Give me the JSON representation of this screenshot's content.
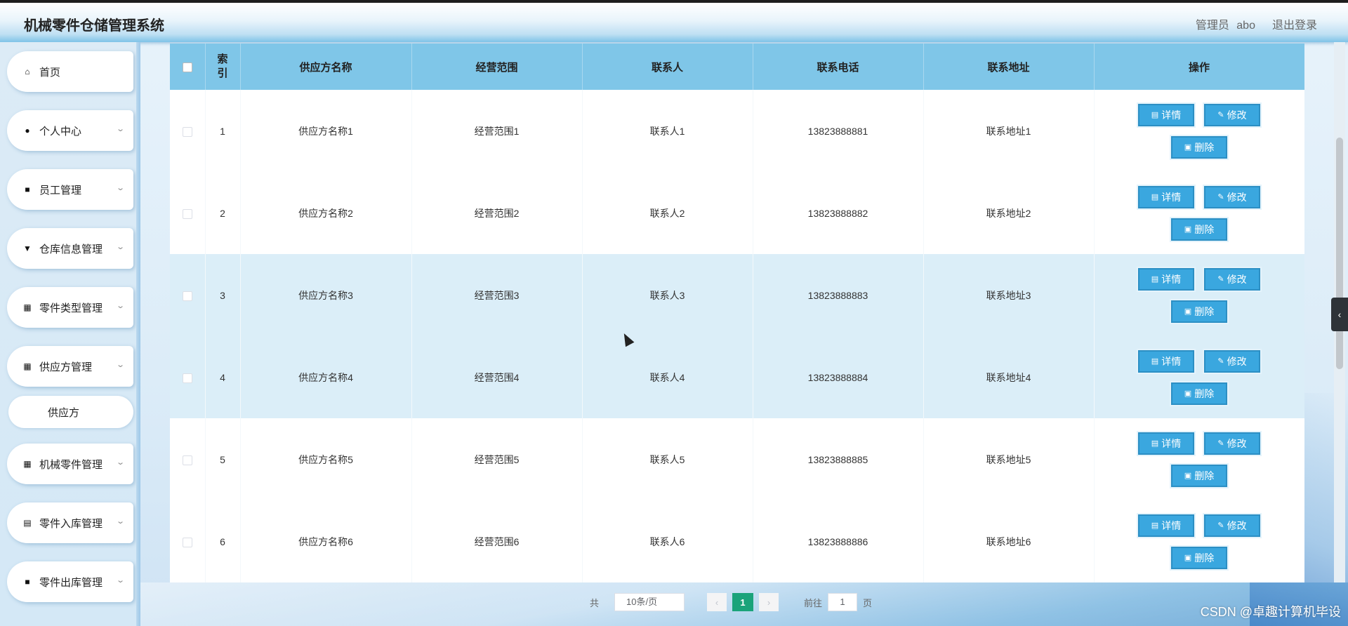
{
  "header": {
    "title": "机械零件仓储管理系统",
    "user_role": "管理员",
    "user_name": "abo",
    "logout": "退出登录"
  },
  "sidebar": {
    "items": [
      {
        "label": "首页",
        "icon": "home-icon",
        "expandable": false
      },
      {
        "label": "个人中心",
        "icon": "user-icon",
        "expandable": true
      },
      {
        "label": "员工管理",
        "icon": "briefcase-icon",
        "expandable": true
      },
      {
        "label": "仓库信息管理",
        "icon": "pin-icon",
        "expandable": true
      },
      {
        "label": "零件类型管理",
        "icon": "grid-icon",
        "expandable": true
      },
      {
        "label": "供应方管理",
        "icon": "grid-icon",
        "expandable": true
      },
      {
        "label": "机械零件管理",
        "icon": "grid-icon",
        "expandable": true
      },
      {
        "label": "零件入库管理",
        "icon": "clipboard-icon",
        "expandable": true
      },
      {
        "label": "零件出库管理",
        "icon": "briefcase-icon",
        "expandable": true
      }
    ],
    "submenu": {
      "label": "供应方"
    }
  },
  "table": {
    "columns": [
      "",
      "索\n引",
      "供应方名称",
      "经营范围",
      "联系人",
      "联系电话",
      "联系地址",
      "操作"
    ],
    "rows": [
      {
        "index": "1",
        "name": "供应方名称1",
        "scope": "经营范围1",
        "contact": "联系人1",
        "phone": "13823888881",
        "address": "联系地址1"
      },
      {
        "index": "2",
        "name": "供应方名称2",
        "scope": "经营范围2",
        "contact": "联系人2",
        "phone": "13823888882",
        "address": "联系地址2"
      },
      {
        "index": "3",
        "name": "供应方名称3",
        "scope": "经营范围3",
        "contact": "联系人3",
        "phone": "13823888883",
        "address": "联系地址3"
      },
      {
        "index": "4",
        "name": "供应方名称4",
        "scope": "经营范围4",
        "contact": "联系人4",
        "phone": "13823888884",
        "address": "联系地址4"
      },
      {
        "index": "5",
        "name": "供应方名称5",
        "scope": "经营范围5",
        "contact": "联系人5",
        "phone": "13823888885",
        "address": "联系地址5"
      },
      {
        "index": "6",
        "name": "供应方名称6",
        "scope": "经营范围6",
        "contact": "联系人6",
        "phone": "13823888886",
        "address": "联系地址6"
      }
    ],
    "actions": {
      "detail": "详情",
      "edit": "修改",
      "delete": "删除"
    }
  },
  "pagination": {
    "total_label": "共",
    "page_size": "10条/页",
    "prev": "‹",
    "current_page": "1",
    "next": "›",
    "goto_label": "前往",
    "goto_value": "1",
    "page_unit": "页"
  },
  "watermark": "CSDN @卓趣计算机毕设",
  "colors": {
    "header_accent": "#7fc3e8",
    "table_header": "#7fc6e8",
    "button": "#3aa7df",
    "page_active": "#1aa37a"
  }
}
